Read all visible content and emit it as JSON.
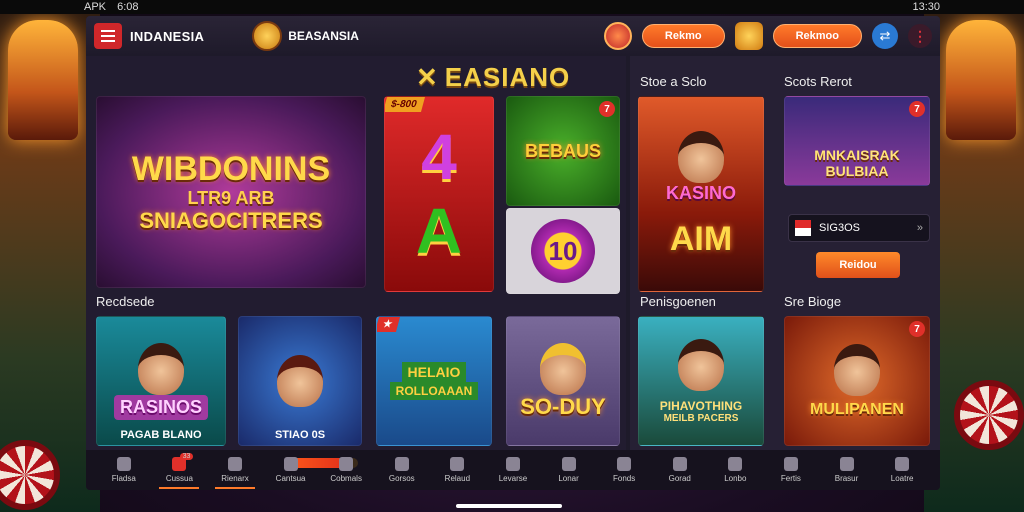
{
  "status_bar": {
    "left": "APK",
    "time": "6:08",
    "right_time": "13:30"
  },
  "top_bar": {
    "brand": "INDANESIA",
    "brand2": "BEASANSIA",
    "pill1": "Rekmo",
    "pill2": "Rekmoo"
  },
  "center_title": "EASIANO",
  "sections": {
    "s1": "Recdsede",
    "s2": "Stoe a Sclo",
    "s3": "Scots Rerot",
    "s4": "Penisgoenen",
    "s5": "Sre Bioge"
  },
  "tiles": {
    "hero_main": "WIBDONINS",
    "hero_mid": "LTR9 ARB",
    "hero_sub": "SNIAGOCITRERS",
    "red_tag": "$-800",
    "red_top": "4",
    "red_bottom": "A",
    "green_title": "BEBAUS",
    "ten": "10",
    "kasino": "KASINO",
    "aim": "AIM",
    "mnkaisrak": "MNKAISRAK",
    "bulbiaa": "BULBIAA",
    "rasinos": "RASINOS",
    "rasinos_caption": "PAGAB BLANO",
    "girl_caption": "STIAO 0S",
    "green_badge": "HELAIO",
    "green_badge2": "ROLLOAAAN",
    "soduy": "SO-DUY",
    "phrav": "PIHAVOTHING",
    "phrav_sub": "MEILB PACERS",
    "mulip": "MULIPANEN",
    "search_text": "SIG3OS",
    "btn_label": "Reidou"
  },
  "bottom_nav": [
    {
      "label": "Fladsa"
    },
    {
      "label": "Cussua",
      "badge": "33"
    },
    {
      "label": "Rienarx"
    },
    {
      "label": "Cantsua"
    },
    {
      "label": "Cobmals"
    },
    {
      "label": "Gorsos"
    },
    {
      "label": "Relaud"
    },
    {
      "label": "Levarse"
    },
    {
      "label": "Lonar"
    },
    {
      "label": "Fonds"
    },
    {
      "label": "Gorad"
    },
    {
      "label": "Lonbo"
    },
    {
      "label": "Fertis"
    },
    {
      "label": "Brasur"
    },
    {
      "label": "Loatre"
    }
  ],
  "nav_progress": 0.85,
  "colors": {
    "accent": "#ff7a2a",
    "danger": "#e0302a",
    "gold": "#f4d04a"
  }
}
